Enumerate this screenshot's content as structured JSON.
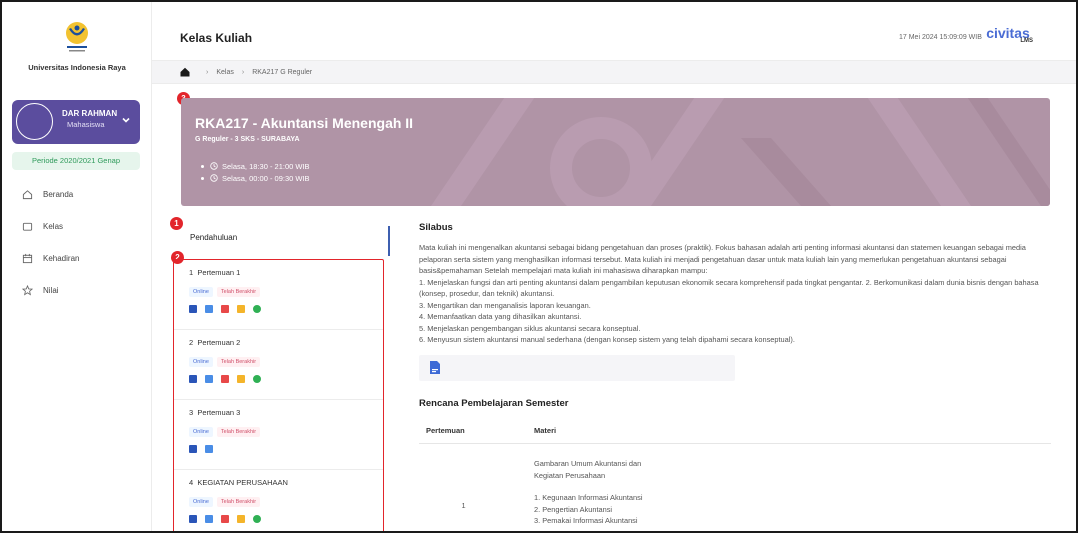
{
  "sidebar": {
    "university_name": "Universitas Indonesia Raya",
    "logo_text": "Universitas Indonesia Raya",
    "user": {
      "name": "DAR RAHMAN",
      "role": "Mahasiswa"
    },
    "period": "Periode 2020/2021 Genap",
    "nav": [
      {
        "label": "Beranda",
        "icon": "home-icon"
      },
      {
        "label": "Kelas",
        "icon": "folder-icon"
      },
      {
        "label": "Kehadiran",
        "icon": "calendar-icon"
      },
      {
        "label": "Nilai",
        "icon": "star-icon"
      }
    ]
  },
  "header": {
    "title": "Kelas Kuliah",
    "datetime": "17 Mei 2024 15:09:09 WIB",
    "brand": "civitas",
    "brand_sub": "LMS"
  },
  "breadcrumb": [
    "Kelas",
    "RKA217 G Reguler"
  ],
  "banner": {
    "badge": "3",
    "course_title": "RKA217 - Akuntansi Menengah II",
    "course_sub": "G Reguler - 3 SKS - SURABAYA",
    "schedule": [
      "Selasa, 18:30 - 21:00 WIB",
      "Selasa, 00:00 - 09:30 WIB"
    ]
  },
  "intro": {
    "badge": "1",
    "label": "Pendahuluan"
  },
  "meetings": {
    "badge": "2",
    "items": [
      {
        "number": "1",
        "title": "Pertemuan 1",
        "tags": [
          "Online",
          "Telah Berakhir"
        ],
        "icons": [
          "book-icon",
          "document-icon",
          "pdf-icon",
          "folder-icon",
          "chat-icon"
        ]
      },
      {
        "number": "2",
        "title": "Pertemuan 2",
        "tags": [
          "Online",
          "Telah Berakhir"
        ],
        "icons": [
          "book-icon",
          "document-icon",
          "pdf-icon",
          "folder-icon",
          "chat-icon"
        ]
      },
      {
        "number": "3",
        "title": "Pertemuan 3",
        "tags": [
          "Online",
          "Telah Berakhir"
        ],
        "icons": [
          "book-icon",
          "document-icon"
        ]
      },
      {
        "number": "4",
        "title": "KEGIATAN PERUSAHAAN",
        "tags": [
          "Online",
          "Telah Berakhir"
        ],
        "icons": [
          "book-icon",
          "document-icon",
          "pdf-icon",
          "folder-icon",
          "chat-icon"
        ]
      }
    ]
  },
  "syllabus": {
    "title": "Silabus",
    "paragraph": "Mata kuliah ini mengenalkan akuntansi sebagai bidang pengetahuan dan proses (praktik). Fokus bahasan adalah arti penting informasi akuntansi dan statemen keuangan sebagai media pelaporan serta sistem yang menghasilkan informasi tersebut. Mata kuliah ini menjadi pengetahuan dasar untuk mata kuliah lain yang memerlukan pengetahuan akuntansi sebagai basis&pemahaman Setelah mempelajari mata kuliah ini mahasiswa diharapkan mampu:",
    "points": [
      "1. Menjelaskan fungsi dan arti penting akuntansi dalam pengambilan keputusan ekonomik secara komprehensif pada tingkat pengantar. 2. Berkomunikasi dalam dunia bisnis dengan bahasa (konsep, prosedur, dan teknik) akuntansi.",
      "3. Mengartikan dan menganalisis laporan keuangan.",
      "4. Memanfaatkan data yang dihasilkan akuntansi.",
      "5. Menjelaskan pengembangan siklus akuntansi secara konseptual.",
      "6. Menyusun sistem akuntansi manual sederhana (dengan konsep sistem yang telah dipahami secara konseptual)."
    ]
  },
  "rps": {
    "title": "Rencana Pembelajaran Semester",
    "headers": [
      "Pertemuan",
      "Materi"
    ],
    "row": {
      "pertemuan": "1",
      "materi_heading": [
        "Gambaran Umum Akuntansi dan",
        "Kegiatan Perusahaan"
      ],
      "materi_list": [
        "1. Kegunaan Informasi Akuntansi",
        "2. Pengertian Akuntansi",
        "3. Pemakai Informasi Akuntansi"
      ]
    }
  }
}
